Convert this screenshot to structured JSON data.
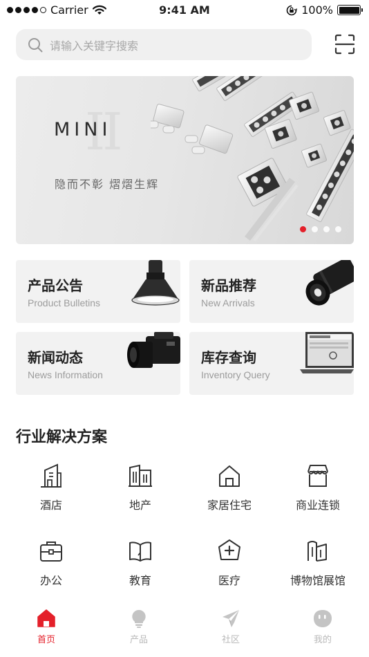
{
  "status_bar": {
    "carrier": "Carrier",
    "time": "9:41 AM",
    "battery": "100%",
    "battery_level": 1.0
  },
  "search": {
    "placeholder": "请输入关键字搜索",
    "search_icon": "search-icon",
    "scan_icon": "scan-icon"
  },
  "banner": {
    "roman": "II",
    "title": "MINI",
    "subtitle": "隐而不彰 熠熠生辉",
    "active_slide": 1,
    "slide_count": 4,
    "accent": "#e4202a"
  },
  "quick_links": [
    {
      "title": "产品公告",
      "subtitle": "Product Bulletins",
      "icon": "pendant-lamp-icon"
    },
    {
      "title": "新品推荐",
      "subtitle": "New Arrivals",
      "icon": "spotlight-icon"
    },
    {
      "title": "新闻动态",
      "subtitle": "News Information",
      "icon": "camera-icon"
    },
    {
      "title": "库存查询",
      "subtitle": "Inventory Query",
      "icon": "laptop-icon"
    }
  ],
  "solutions": {
    "title": "行业解决方案",
    "items": [
      {
        "label": "酒店",
        "icon": "hotel-building-icon"
      },
      {
        "label": "地产",
        "icon": "real-estate-icon"
      },
      {
        "label": "家居住宅",
        "icon": "home-icon"
      },
      {
        "label": "商业连锁",
        "icon": "store-icon"
      },
      {
        "label": "办公",
        "icon": "briefcase-icon"
      },
      {
        "label": "教育",
        "icon": "book-icon"
      },
      {
        "label": "医疗",
        "icon": "medical-cross-icon"
      },
      {
        "label": "博物馆展馆",
        "icon": "museum-icon"
      }
    ]
  },
  "tabbar": {
    "active_color": "#e4202a",
    "inactive_color": "#c4c4c4",
    "tabs": [
      {
        "label": "首页",
        "icon": "home-tab-icon",
        "active": true
      },
      {
        "label": "产品",
        "icon": "bulb-tab-icon",
        "active": false
      },
      {
        "label": "社区",
        "icon": "paper-plane-tab-icon",
        "active": false
      },
      {
        "label": "我的",
        "icon": "profile-tab-icon",
        "active": false
      }
    ]
  }
}
